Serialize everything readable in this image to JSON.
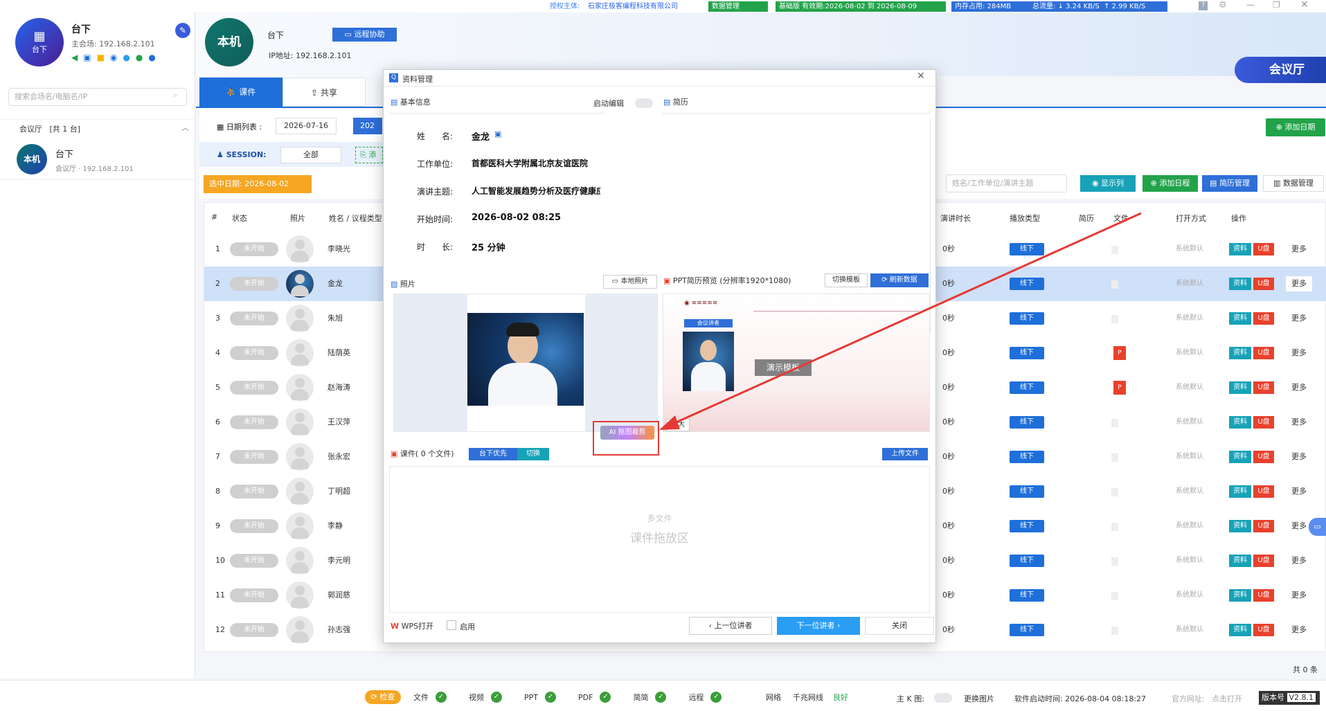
{
  "topbar": {
    "auth_label": "授权主体:",
    "auth_company": "石家庄极客编程科技有限公司",
    "data_mgmt": "数据管理",
    "license": "基础版 有效期:2026-08-02 到 2026-08-09",
    "memory": "内存占用: 284MB",
    "traffic_label": "总流量:",
    "down": "↓ 3.24 KB/S",
    "up": "↑ 2.99 KB/S"
  },
  "left": {
    "venue_icon_label": "台下",
    "name": "台下",
    "main_venue": "主会场: 192.168.2.101",
    "search_placeholder": "搜索会场名/电脑名/IP",
    "group_title": "会议厅",
    "group_count": "[共 1 台]",
    "item_avatar": "本机",
    "item_name": "台下",
    "item_sub": "会议厅 · 192.168.2.101"
  },
  "header": {
    "avatar": "本机",
    "name": "台下",
    "remote_btn": "远程协助",
    "ip": "IP地址: 192.168.2.101",
    "hall": "会议厅",
    "add_date": "添加日期"
  },
  "tabs": [
    "课件",
    "共享"
  ],
  "filter": {
    "date_list_label": "日期列表 :",
    "date_value": "2026-07-16",
    "date_value2": "202",
    "session_label": "SESSION:",
    "session_value": "全部",
    "selected_date": "选中日期: 2026-08-02",
    "search_placeholder": "姓名/工作单位/演讲主题",
    "show_cols": "显示列",
    "add_schedule": "添加日程",
    "resume_mgmt": "简历管理",
    "data_mgmt": "数据管理",
    "add_partial": "添"
  },
  "table": {
    "headers": [
      "#",
      "状态",
      "照片",
      "姓名 / 议程类型",
      "演讲时长",
      "播放类型",
      "简历",
      "文件",
      "打开方式",
      "操作"
    ],
    "rows": [
      {
        "n": "1",
        "status": "未开始",
        "name": "李晓光",
        "dur": "0秒",
        "play": "线下",
        "open": "系统默认",
        "more": "更多"
      },
      {
        "n": "2",
        "status": "未开始",
        "name": "金龙",
        "dur": "0秒",
        "play": "线下",
        "open": "系统默认",
        "more": "更多"
      },
      {
        "n": "3",
        "status": "未开始",
        "name": "朱旭",
        "dur": "0秒",
        "play": "线下",
        "open": "系统默认",
        "more": "更多"
      },
      {
        "n": "4",
        "status": "未开始",
        "name": "陆荫英",
        "dur": "0秒",
        "play": "线下",
        "open": "系统默认",
        "more": "更多"
      },
      {
        "n": "5",
        "status": "未开始",
        "name": "赵海涛",
        "dur": "0秒",
        "play": "线下",
        "open": "系统默认",
        "more": "更多"
      },
      {
        "n": "6",
        "status": "未开始",
        "name": "王汉萍",
        "dur": "0秒",
        "play": "线下",
        "open": "系统默认",
        "more": "更多"
      },
      {
        "n": "7",
        "status": "未开始",
        "name": "张永宏",
        "dur": "0秒",
        "play": "线下",
        "open": "系统默认",
        "more": "更多"
      },
      {
        "n": "8",
        "status": "未开始",
        "name": "丁明超",
        "dur": "0秒",
        "play": "线下",
        "open": "系统默认",
        "more": "更多"
      },
      {
        "n": "9",
        "status": "未开始",
        "name": "李静",
        "dur": "0秒",
        "play": "线下",
        "open": "系统默认",
        "more": "更多"
      },
      {
        "n": "10",
        "status": "未开始",
        "name": "李元明",
        "dur": "0秒",
        "play": "线下",
        "open": "系统默认",
        "more": "更多"
      },
      {
        "n": "11",
        "status": "未开始",
        "name": "郭润慈",
        "dur": "0秒",
        "play": "线下",
        "open": "系统默认",
        "more": "更多"
      },
      {
        "n": "12",
        "status": "未开始",
        "name": "孙志强",
        "dur": "0秒",
        "play": "线下",
        "open": "系统默认",
        "more": "更多"
      }
    ],
    "btn_data": "资料",
    "btn_u": "U盘",
    "total": "共 0 条"
  },
  "dialog": {
    "title": "资料管理",
    "basic_info": "基本信息",
    "enable_edit": "启动编辑",
    "resume": "简历",
    "name_label": "姓　　名:",
    "name": "金龙",
    "org_label": "工作单位:",
    "org": "首都医科大学附属北京友谊医院",
    "topic_label": "演讲主题:",
    "topic": "人工智能发展趋势分析及医疗健康应用",
    "start_label": "开始时间:",
    "start": "2026-08-02 08:25",
    "dur_label": "时　　长:",
    "dur": "25 分钟",
    "photo": "照片",
    "local_photo": "本地照片",
    "ai_crop": "AI 抠图裁剪",
    "ppt_preview": "PPT简历预览 (分辨率1920*1080)",
    "switch_tpl": "切换模板",
    "refresh": "刷新数据",
    "tpl_text": "演示模板",
    "tpl_speaker": "会议讲者",
    "zoom": "放大",
    "courseware": "课件( 0 个文件)",
    "prio": "台下优先",
    "switch": "切换",
    "upload": "上传文件",
    "drop_small": "多文件",
    "drop_big": "课件拖放区",
    "wps": "WPS打开",
    "enable": "启用",
    "prev": "上一位讲者",
    "next": "下一位讲者",
    "close": "关闭"
  },
  "status": {
    "check": "检查",
    "items": [
      "文件",
      "视频",
      "PPT",
      "PDF",
      "简简",
      "远程"
    ],
    "network": "网络",
    "gigabit": "千兆网线",
    "good": "良好",
    "mainK": "主 K 图:",
    "replace_img": "更换图片",
    "start_time": "软件启动时间: 2026-08-04 08:18:27",
    "official": "官方网址:",
    "open_link": "点击打开",
    "version_label": "版本号",
    "version": "V2.8.1"
  }
}
